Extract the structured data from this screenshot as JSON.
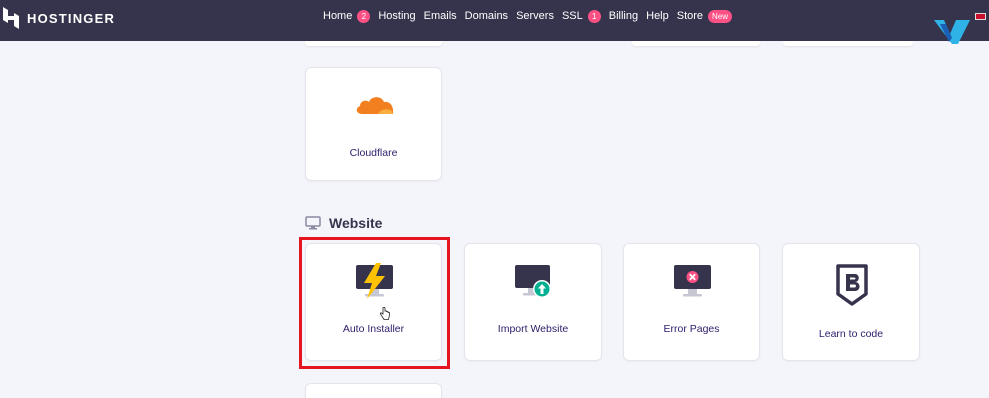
{
  "header": {
    "logo_text": "HOSTINGER",
    "nav": [
      {
        "label": "Home",
        "badge": "2"
      },
      {
        "label": "Hosting"
      },
      {
        "label": "Emails"
      },
      {
        "label": "Domains"
      },
      {
        "label": "Servers"
      },
      {
        "label": "SSL",
        "badge": "1"
      },
      {
        "label": "Billing"
      },
      {
        "label": "Help"
      },
      {
        "label": "Store",
        "badge": "New"
      }
    ]
  },
  "cards_top": {
    "cloudflare": {
      "label": "Cloudflare",
      "icon": "cloudflare-icon"
    }
  },
  "website_section": {
    "title": "Website",
    "icon": "monitor-icon",
    "cards": [
      {
        "label": "Auto Installer",
        "icon": "auto-installer-icon"
      },
      {
        "label": "Import Website",
        "icon": "import-website-icon"
      },
      {
        "label": "Error Pages",
        "icon": "error-pages-icon"
      },
      {
        "label": "Learn to code",
        "icon": "learn-to-code-icon"
      }
    ]
  },
  "colors": {
    "topbar": "#36344d",
    "badge": "#fc5185",
    "highlight": "#e4151f",
    "cloudflare": "#f38020",
    "bolt": "#ffc200",
    "success": "#00b090",
    "error": "#fc5185"
  }
}
